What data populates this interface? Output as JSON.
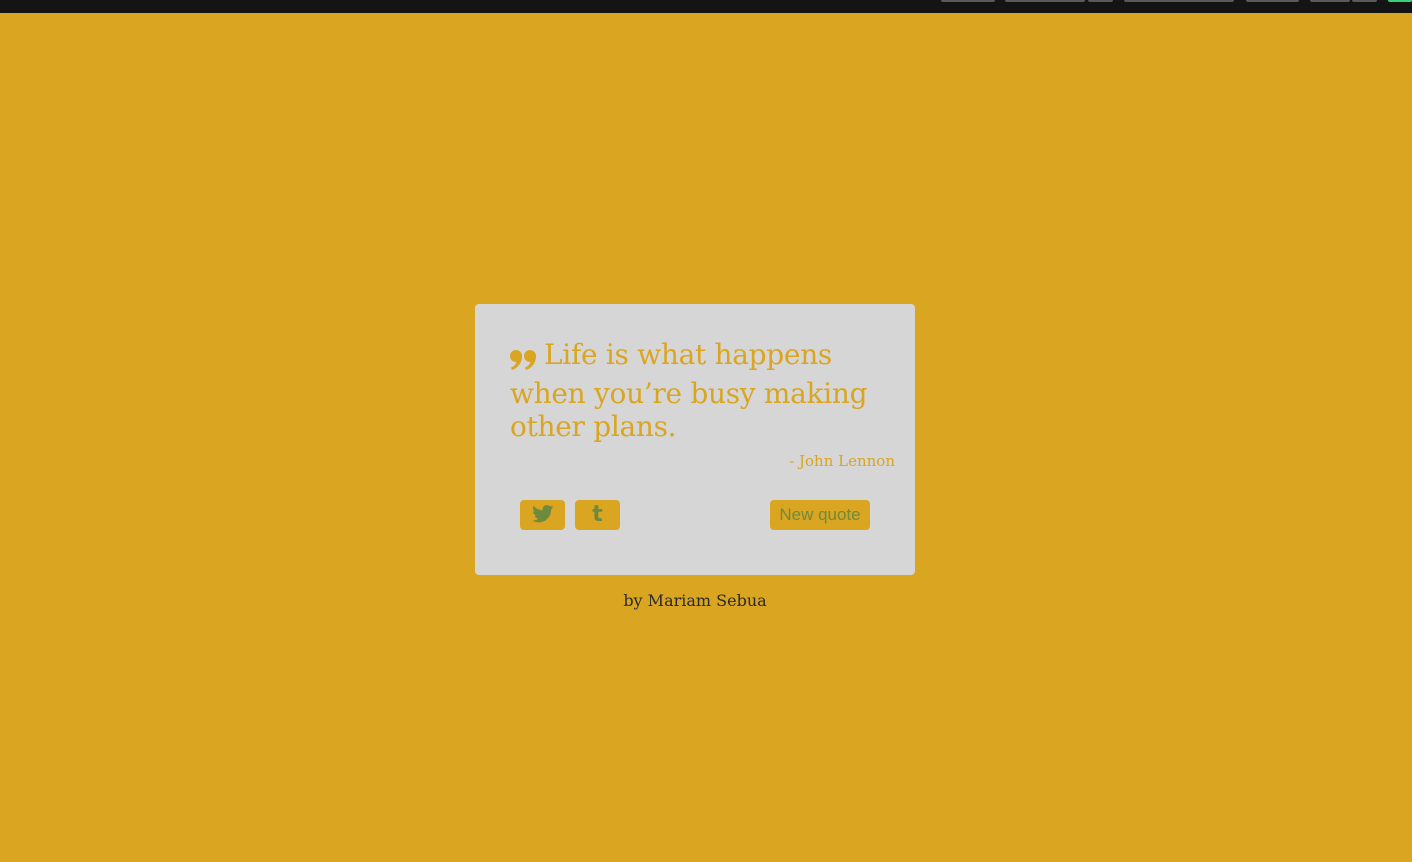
{
  "quote": {
    "text": "Life is what happens when you’re busy making other plans.",
    "author": "- John Lennon",
    "icon": "quote-left-icon"
  },
  "buttons": {
    "twitter_icon": "twitter-icon",
    "tumblr_icon": "tumblr-icon",
    "tumblr_glyph": "t",
    "new_quote": "New quote"
  },
  "footer": {
    "credit": "by Mariam Sebua"
  },
  "colors": {
    "background": "#DAA520",
    "card": "#D6D6D6",
    "button_text": "#6E8B3D"
  }
}
